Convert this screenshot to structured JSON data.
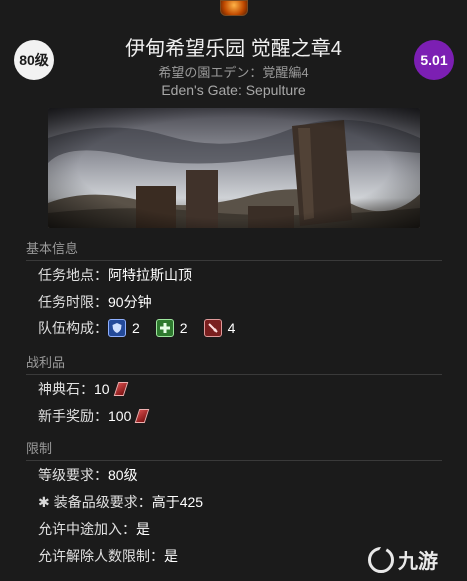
{
  "header": {
    "level_badge": "80级",
    "ilvl_badge": "5.01",
    "title": "伊甸希望乐园 觉醒之章4",
    "subtitle_jp": "希望の園エデン：覚醒編4",
    "subtitle_en": "Eden's Gate: Sepulture",
    "ilvl_badge_color": "#7c1fb3"
  },
  "basic_info": {
    "section_title": "基本信息",
    "location_label": "任务地点：",
    "location_value": "阿特拉斯山顶",
    "time_label": "任务时限：",
    "time_value": "90分钟",
    "party_label": "队伍构成：",
    "party": [
      {
        "role": "tank",
        "icon": "shield-icon",
        "count": "2"
      },
      {
        "role": "healer",
        "icon": "cross-icon",
        "count": "2"
      },
      {
        "role": "dps",
        "icon": "sword-icon",
        "count": "4"
      }
    ]
  },
  "loot": {
    "section_title": "战利品",
    "tomestone_label": "神典石：",
    "tomestone_value": "10",
    "rookie_label": "新手奖励：",
    "rookie_value": "100"
  },
  "limits": {
    "section_title": "限制",
    "level_req_label": "等级要求：",
    "level_req_value": "80级",
    "ilvl_req_label": "装备品级要求：",
    "ilvl_req_value": "高于425",
    "join_label": "允许中途加入：",
    "join_value": "是",
    "unrestricted_label": "允许解除人数限制：",
    "unrestricted_value": "是"
  },
  "watermark": {
    "text": "九游"
  }
}
